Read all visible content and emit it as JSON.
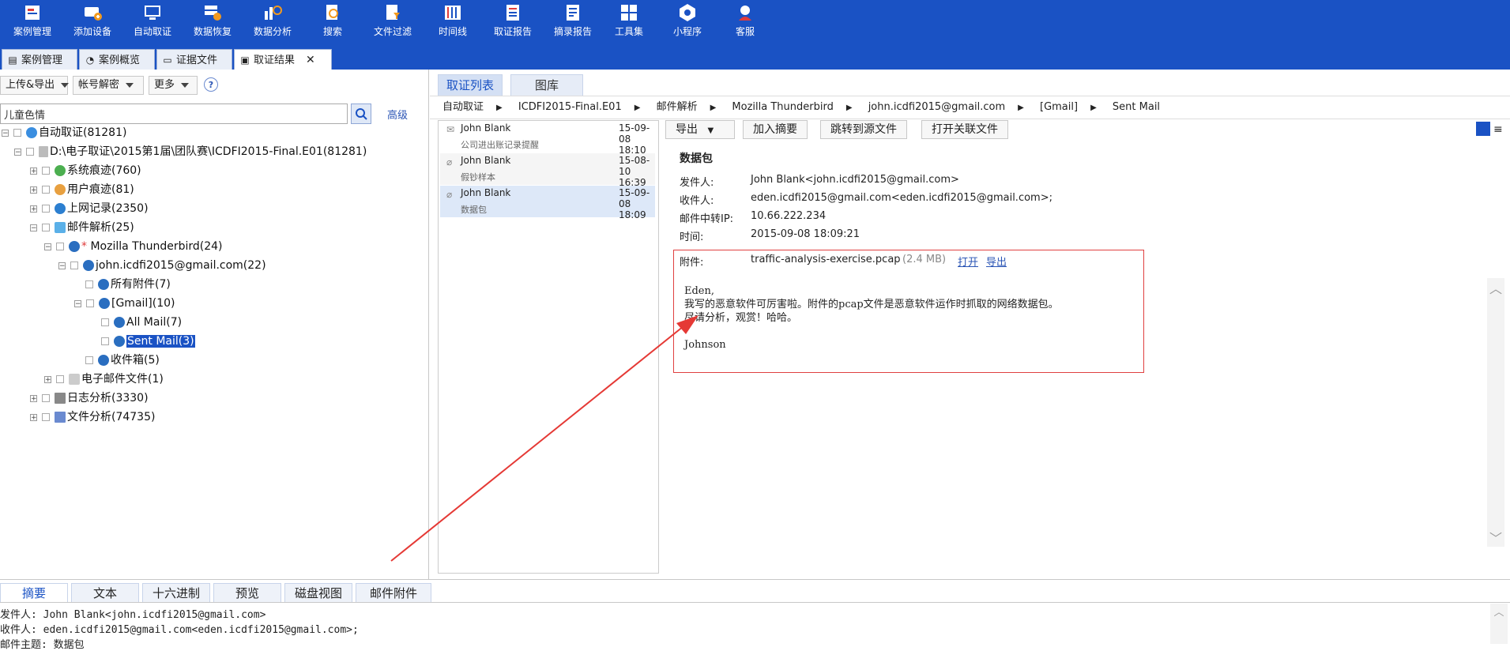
{
  "toolbar": {
    "items": [
      {
        "label": "案例管理",
        "icon": "case-manage-icon"
      },
      {
        "label": "添加设备",
        "icon": "add-device-icon"
      },
      {
        "label": "自动取证",
        "icon": "auto-forensic-icon"
      },
      {
        "label": "数据恢复",
        "icon": "data-recovery-icon"
      },
      {
        "label": "数据分析",
        "icon": "data-analysis-icon"
      },
      {
        "label": "搜索",
        "icon": "search-icon"
      },
      {
        "label": "文件过滤",
        "icon": "file-filter-icon"
      },
      {
        "label": "时间线",
        "icon": "timeline-icon"
      },
      {
        "label": "取证报告",
        "icon": "report-icon"
      },
      {
        "label": "摘录报告",
        "icon": "excerpt-report-icon"
      },
      {
        "label": "工具集",
        "icon": "toolkit-icon"
      },
      {
        "label": "小程序",
        "icon": "mini-program-icon"
      },
      {
        "label": "客服",
        "icon": "customer-service-icon"
      }
    ]
  },
  "tabs": [
    {
      "label": "案例管理",
      "icon": "case-icon"
    },
    {
      "label": "案例概览",
      "icon": "overview-icon"
    },
    {
      "label": "证据文件",
      "icon": "evidence-icon"
    },
    {
      "label": "取证结果",
      "icon": "result-icon",
      "active": true
    }
  ],
  "left": {
    "upload_export": "上传&导出",
    "account_decrypt": "帐号解密",
    "more": "更多",
    "help": "?",
    "search_value": "儿童色情",
    "advanced": "高级"
  },
  "tree": [
    {
      "label": "自动取证(81281)"
    },
    {
      "label": "D:\\电子取证\\2015第1届\\团队赛\\ICDFI2015-Final.E01(81281)"
    },
    {
      "label": "系统痕迹(760)"
    },
    {
      "label": "用户痕迹(81)"
    },
    {
      "label": "上网记录(2350)"
    },
    {
      "label": "邮件解析(25)"
    },
    {
      "label": "Mozilla Thunderbird(24)"
    },
    {
      "label": "john.icdfi2015@gmail.com(22)"
    },
    {
      "label": "所有附件(7)"
    },
    {
      "label": "[Gmail](10)"
    },
    {
      "label": "All Mail(7)"
    },
    {
      "label": "Sent Mail(3)"
    },
    {
      "label": "收件箱(5)"
    },
    {
      "label": "电子邮件文件(1)"
    },
    {
      "label": "日志分析(3330)"
    },
    {
      "label": "文件分析(74735)"
    }
  ],
  "right": {
    "tab_list": "取证列表",
    "tab_gallery": "图库",
    "breadcrumb": [
      "自动取证",
      "ICDFI2015-Final.E01",
      "邮件解析",
      "Mozilla Thunderbird",
      "john.icdfi2015@gmail.com",
      "[Gmail]",
      "Sent Mail"
    ]
  },
  "mail_list": [
    {
      "from": "John Blank",
      "date": "15-09-08 18:10",
      "subject": "公司进出账记录提醒"
    },
    {
      "from": "John Blank",
      "date": "15-08-10 16:39",
      "subject": "假钞样本"
    },
    {
      "from": "John Blank",
      "date": "15-09-08 18:09",
      "subject": "数据包"
    }
  ],
  "detail": {
    "export": "导出",
    "add_excerpt": "加入摘要",
    "jump_source": "跳转到源文件",
    "open_related": "打开关联文件",
    "subject": "数据包",
    "from_label": "发件人:",
    "from_value": "John Blank<john.icdfi2015@gmail.com>",
    "to_label": "收件人:",
    "to_value": "eden.icdfi2015@gmail.com<eden.icdfi2015@gmail.com>;",
    "ip_label": "邮件中转IP:",
    "ip_value": "10.66.222.234",
    "time_label": "时间:",
    "time_value": "2015-09-08 18:09:21",
    "attach_label": "附件:",
    "attach_name": "traffic-analysis-exercise.pcap",
    "attach_size": "(2.4 MB)",
    "open": "打开",
    "export_link": "导出",
    "body": "Eden,\n我写的恶意软件可厉害啦。附件的pcap文件是恶意软件运作时抓取的网络数据包。\n尽请分析，观赏！哈哈。\n\nJohnson"
  },
  "bottom": {
    "tabs": [
      "摘要",
      "文本",
      "十六进制",
      "预览",
      "磁盘视图",
      "邮件附件"
    ],
    "line1": "发件人: John Blank<john.icdfi2015@gmail.com>",
    "line2": "收件人: eden.icdfi2015@gmail.com<eden.icdfi2015@gmail.com>;",
    "line3": "邮件主题: 数据包"
  },
  "colors": {
    "brand": "#1a52c4",
    "annotation": "#e04040"
  }
}
